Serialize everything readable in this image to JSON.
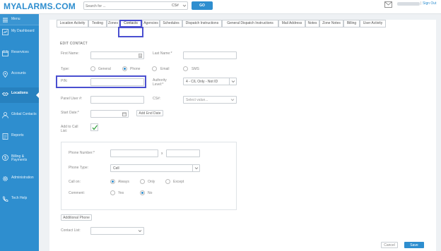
{
  "header": {
    "logo": "MYALARMS.COM",
    "search_placeholder": "Search for ...",
    "search_scope": "CS#",
    "go_label": "GO",
    "signout_label": "Sign Out",
    "separator": "|"
  },
  "sidebar": {
    "menu_label": "Menu",
    "items": [
      {
        "label": "My Dashboard",
        "icon": "dashboard-icon"
      },
      {
        "label": "Reservices",
        "icon": "calendar-icon"
      },
      {
        "label": "Accounts",
        "icon": "location-pin-icon"
      },
      {
        "label": "Locations",
        "icon": "handshake-icon"
      },
      {
        "label": "Global Contacts",
        "icon": "person-icon"
      },
      {
        "label": "Reports",
        "icon": "report-icon"
      },
      {
        "label": "Billing & Payments",
        "icon": "dollar-icon"
      },
      {
        "label": "Administration",
        "icon": "gear-icon"
      },
      {
        "label": "Tech Help",
        "icon": "phone-icon"
      }
    ],
    "active_index": 3
  },
  "tabs": [
    "Location Activity",
    "Testing",
    "Zones",
    "Contacts",
    "Agencies",
    "Schedules",
    "Dispatch Instructions",
    "General Dispatch Instructions",
    "Mail Address",
    "Notes",
    "Zone Notes",
    "Billing",
    "User Activity"
  ],
  "active_tab": "Contacts",
  "form": {
    "title": "EDIT CONTACT",
    "first_name_label": "First Name:",
    "last_name_label": "Last Name:*",
    "type_label": "Type:",
    "type_options": [
      "General",
      "Phone",
      "Email",
      "SMS"
    ],
    "type_selected": "Phone",
    "pin_label": "PIN:",
    "authority_label": "Authority Level:*",
    "authority_value": "4 - C/L Only - Not ID",
    "panel_user_label": "Panel User #:",
    "csr_label": "CS#:",
    "csr_value": "Select value...",
    "start_date_label": "Start Date:*",
    "add_end_date_label": "Add End Date",
    "add_to_call_list_label": "Add to Call List:",
    "add_to_call_list_checked": true,
    "phone_number_label": "Phone Number:*",
    "phone_ext_separator": "x",
    "phone_type_label": "Phone Type:",
    "phone_type_value": "Cell",
    "call_on_label": "Call on:",
    "call_on_options": [
      "Always",
      "Only",
      "Except"
    ],
    "call_on_selected": "Always",
    "comment_label": "Comment:",
    "comment_options": [
      "Yes",
      "No"
    ],
    "comment_selected": "No",
    "additional_phone_label": "Additional Phone",
    "contact_list_label": "Contact List:"
  },
  "footer": {
    "cancel_label": "Cancel",
    "save_label": "Save"
  },
  "colors": {
    "brand": "#2e8ecf",
    "highlight": "#4a4fd0",
    "check": "#2e9e3a"
  }
}
